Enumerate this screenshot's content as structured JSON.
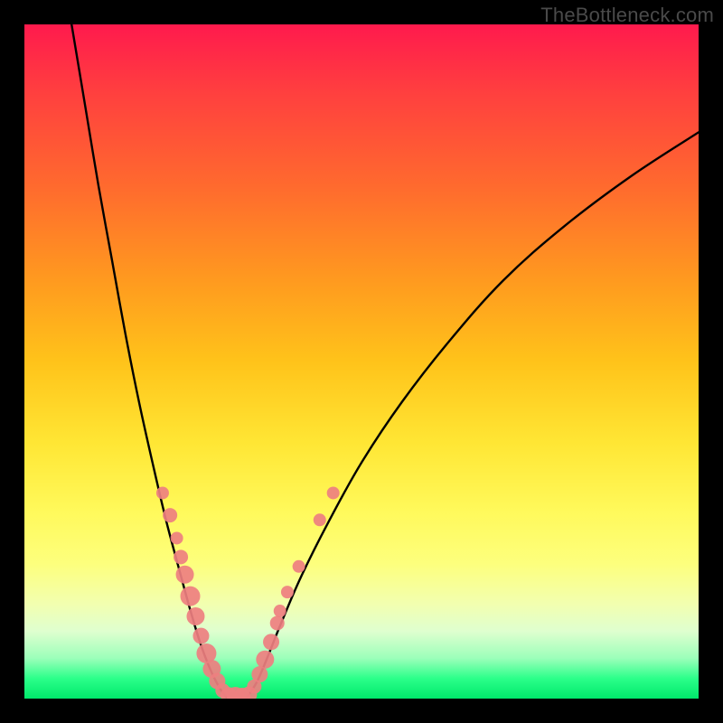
{
  "watermark": "TheBottleneck.com",
  "chart_data": {
    "type": "line",
    "title": "",
    "xlabel": "",
    "ylabel": "",
    "xlim": [
      0,
      100
    ],
    "ylim": [
      0,
      100
    ],
    "series": [
      {
        "name": "left-curve",
        "x": [
          7,
          9,
          11,
          13,
          15,
          17,
          19,
          21,
          23,
          24.5,
          26,
          27.5,
          29,
          30
        ],
        "y": [
          100,
          88,
          76,
          65,
          54,
          44,
          35,
          26.5,
          19,
          13.5,
          8.5,
          4.5,
          1.5,
          0.2
        ]
      },
      {
        "name": "right-curve",
        "x": [
          33,
          34.5,
          36,
          38,
          41,
          45,
          50,
          56,
          63,
          71,
          80,
          90,
          100
        ],
        "y": [
          0.2,
          2.5,
          6,
          11,
          18,
          26,
          35,
          44,
          53,
          62,
          70,
          77.5,
          84
        ]
      }
    ],
    "scatter": [
      {
        "name": "left-dots",
        "color": "#ee7f80",
        "points": [
          [
            20.5,
            30.5,
            7
          ],
          [
            21.6,
            27.2,
            8
          ],
          [
            22.6,
            23.8,
            7
          ],
          [
            23.2,
            21.0,
            8
          ],
          [
            23.8,
            18.4,
            10
          ],
          [
            24.6,
            15.2,
            11
          ],
          [
            25.4,
            12.2,
            10
          ],
          [
            26.2,
            9.3,
            9
          ],
          [
            27.0,
            6.7,
            11
          ],
          [
            27.8,
            4.4,
            10
          ],
          [
            28.6,
            2.6,
            9
          ],
          [
            29.4,
            1.2,
            8
          ],
          [
            30.3,
            0.5,
            9
          ],
          [
            31.3,
            0.4,
            10
          ],
          [
            32.3,
            0.4,
            9
          ]
        ]
      },
      {
        "name": "right-dots",
        "color": "#ee7f80",
        "points": [
          [
            33.3,
            0.6,
            9
          ],
          [
            34.1,
            1.8,
            8
          ],
          [
            34.9,
            3.6,
            9
          ],
          [
            35.7,
            5.8,
            10
          ],
          [
            36.6,
            8.4,
            9
          ],
          [
            37.5,
            11.2,
            8
          ],
          [
            37.9,
            13.0,
            7
          ],
          [
            39.0,
            15.8,
            7
          ],
          [
            40.7,
            19.6,
            7
          ],
          [
            43.8,
            26.5,
            7
          ],
          [
            45.8,
            30.5,
            7
          ]
        ]
      }
    ],
    "gradient_stops": [
      [
        "#ff1a4d",
        0
      ],
      [
        "#ff3f3f",
        10
      ],
      [
        "#ff6a2e",
        24
      ],
      [
        "#ff9a1f",
        38
      ],
      [
        "#ffc31a",
        50
      ],
      [
        "#ffe634",
        62
      ],
      [
        "#fff95a",
        72
      ],
      [
        "#fdff7d",
        80
      ],
      [
        "#f2ffb0",
        86
      ],
      [
        "#dfffcf",
        90
      ],
      [
        "#9cffba",
        94
      ],
      [
        "#2cff8a",
        97
      ],
      [
        "#00e86b",
        100
      ]
    ]
  }
}
